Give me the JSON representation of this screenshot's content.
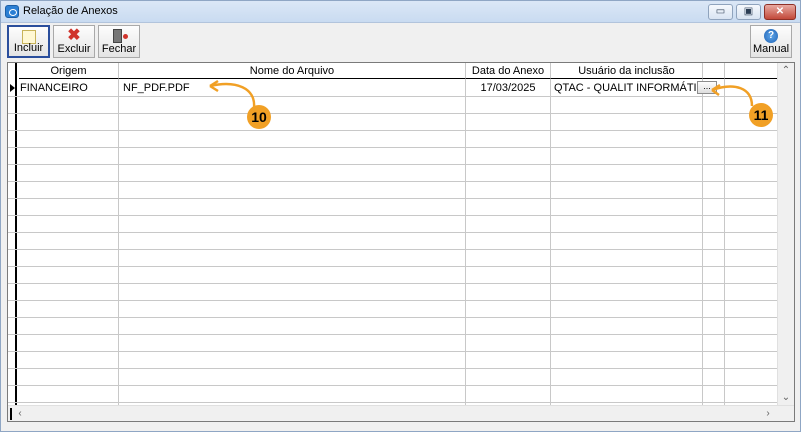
{
  "window": {
    "title": "Relação de Anexos",
    "controls": {
      "minimize": "▭",
      "restore": "▣",
      "close": "✕"
    }
  },
  "toolbar": {
    "incluir_label": "Incluir",
    "excluir_label": "Excluir",
    "fechar_label": "Fechar",
    "manual_label": "Manual",
    "manual_icon_glyph": "?"
  },
  "grid": {
    "columns": [
      "Origem",
      "Nome do Arquivo",
      "Data do Anexo",
      "Usuário da inclusão"
    ],
    "rows": [
      {
        "origem": "FINANCEIRO",
        "nome_arquivo": "NF_PDF.PDF",
        "data_anexo": "17/03/2025",
        "usuario": "QTAC - QUALIT INFORMÁTICA",
        "action": "..."
      }
    ]
  },
  "callouts": {
    "badge_10": "10",
    "badge_11": "11"
  },
  "colors": {
    "badge": "#f1a025",
    "titlebar": "#c9dbf1",
    "active_border": "#2a4e9c"
  }
}
